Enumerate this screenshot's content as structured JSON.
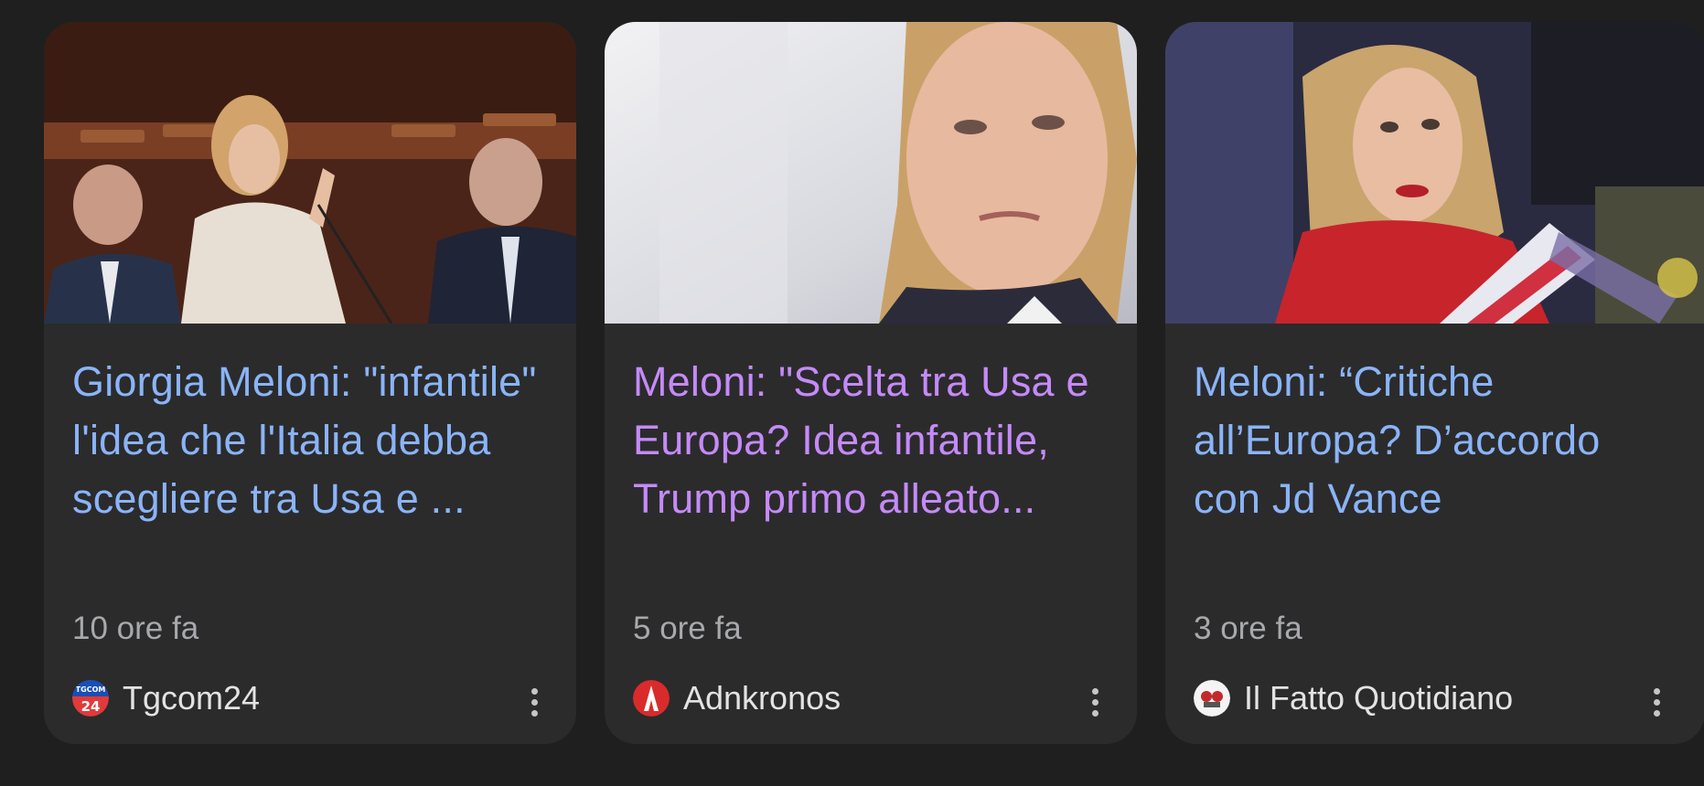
{
  "colors": {
    "background": "#1f1f1f",
    "card": "#2b2b2c",
    "link_unvisited": "#8ab4f8",
    "link_visited": "#c58af9",
    "meta_text": "#a8a9ac",
    "source_text": "#e3e3e3"
  },
  "cards": [
    {
      "headline": "Giorgia Meloni: \"infantile\" l'idea che l'Italia debba scegliere tra Usa e ...",
      "time": "10 ore fa",
      "source": "Tgcom24",
      "logo_text": "TGCOM",
      "logo_number": "24",
      "visited": false,
      "thumbnail": "photo of Giorgia Meloni speaking in parliament",
      "menu_icon": "more-vert-icon"
    },
    {
      "headline": "Meloni: \"Scelta tra Usa e Europa? Idea infantile, Trump primo alleato...",
      "time": "5 ore fa",
      "source": "Adnkronos",
      "visited": true,
      "thumbnail": "close-up photo of Giorgia Meloni",
      "menu_icon": "more-vert-icon"
    },
    {
      "headline": "Meloni: “Critiche all’Europa? D’accordo con Jd Vance",
      "time": "3 ore fa",
      "source": "Il Fatto Quotidiano",
      "visited": false,
      "thumbnail": "photo of Giorgia Meloni in red jacket with flag",
      "menu_icon": "more-vert-icon"
    }
  ]
}
